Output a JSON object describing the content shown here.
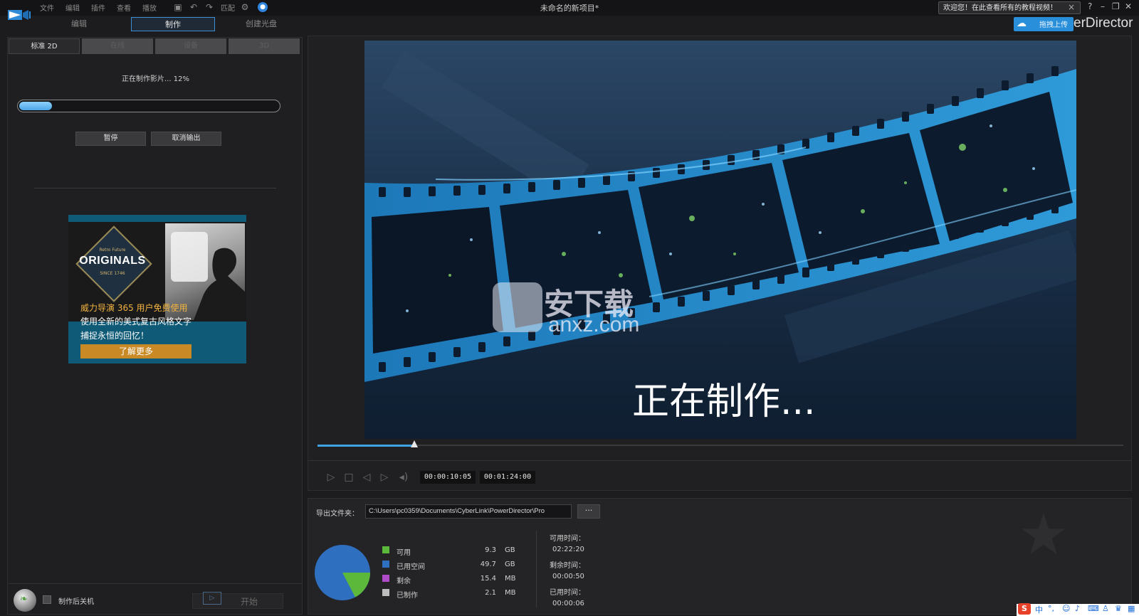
{
  "titlebar": {
    "menus": [
      "文件",
      "编辑",
      "插件",
      "查看",
      "播放"
    ],
    "resolution": "匹配",
    "doc_title": "未命名的新项目*",
    "welcome": "欢迎您！在此查看所有的教程视频！",
    "help": "?"
  },
  "modes": {
    "edit": "编辑",
    "produce": "制作",
    "disc": "创建光盘"
  },
  "cloud_button": "拖拽上传",
  "brand": "erDirector",
  "subtabs": [
    "标准 2D",
    "在线",
    "设备",
    "3D"
  ],
  "progress": {
    "label": "正在制作影片... 12%",
    "fraction": 0.12
  },
  "buttons": {
    "pause": "暂停",
    "cancel": "取消输出"
  },
  "ad": {
    "retro": "Retro Future",
    "originals": "ORIGINALS",
    "since": "SINCE 1746",
    "line1": "威力导演 365 用户免费使用",
    "line2": "使用全新的美式复古风格文字",
    "line3": "捕捉永恒的回忆！",
    "learn_more": "了解更多"
  },
  "shutdown_label": "制作后关机",
  "start_label": "开始",
  "preview": {
    "overlay_text": "正在制作...",
    "watermark_cn": "安下载",
    "watermark_en": "anxz.com",
    "scrub_fraction": 0.12
  },
  "timecodes": {
    "current": "00:00:10:05",
    "total": "00:01:24:00"
  },
  "output": {
    "folder_label": "导出文件夹：",
    "folder_path": "C:\\Users\\pc0359\\Documents\\CyberLink\\PowerDirector\\Pro",
    "browse": "···"
  },
  "storage": [
    {
      "label": "可用",
      "value": "9.3",
      "unit": "GB",
      "color": "#5cb83a"
    },
    {
      "label": "已用空间",
      "value": "49.7",
      "unit": "GB",
      "color": "#2f6fc0"
    },
    {
      "label": "剩余",
      "value": "15.4",
      "unit": "MB",
      "color": "#b04cc8"
    },
    {
      "label": "已制作",
      "value": "2.1",
      "unit": "MB",
      "color": "#bdbdbd"
    }
  ],
  "times": {
    "available_label": "可用时间：",
    "available": "02:22:20",
    "remaining_label": "剩余时间：",
    "remaining": "00:00:50",
    "elapsed_label": "已用时间：",
    "elapsed": "00:00:06"
  },
  "ime": {
    "lang": "中"
  }
}
